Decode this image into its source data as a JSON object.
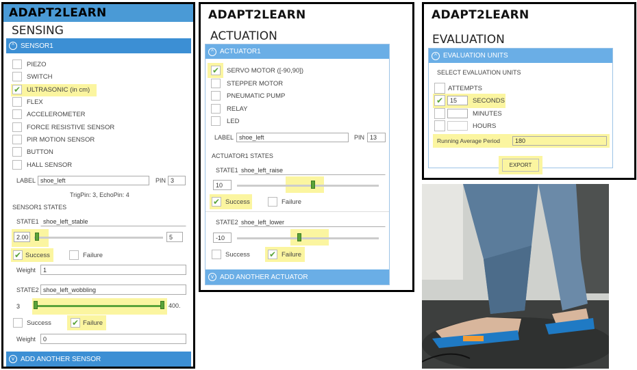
{
  "brand": "ADAPT2LEARN",
  "sensing": {
    "title": "SENSING",
    "sensor_bar": "SENSOR1",
    "sensors": [
      {
        "label": "PIEZO",
        "checked": false
      },
      {
        "label": "SWITCH",
        "checked": false
      },
      {
        "label": "ULTRASONIC (in cm)",
        "checked": true
      },
      {
        "label": "FLEX",
        "checked": false
      },
      {
        "label": "ACCELEROMETER",
        "checked": false
      },
      {
        "label": "FORCE RESISTIVE SENSOR",
        "checked": false
      },
      {
        "label": "PIR MOTION SENSOR",
        "checked": false
      },
      {
        "label": "BUTTON",
        "checked": false
      },
      {
        "label": "HALL SENSOR",
        "checked": false
      }
    ],
    "label_caption": "LABEL",
    "label_value": "shoe_left",
    "pin_caption": "PIN",
    "pin_value": "3",
    "pins_note": "TrigPin: 3, EchoPin: 4",
    "states_title": "SENSOR1 STATES",
    "state1": {
      "caption": "STATE1",
      "name": "shoe_left_stable",
      "min": "2.00",
      "max": "5",
      "success_label": "Success",
      "failure_label": "Failure",
      "weight_caption": "Weight",
      "weight_value": "1"
    },
    "state2": {
      "caption": "STATE2",
      "name": "shoe_left_wobbling",
      "min": "3",
      "max": "400.",
      "success_label": "Success",
      "failure_label": "Failure",
      "weight_caption": "Weight",
      "weight_value": "0"
    },
    "add_button": "ADD ANOTHER SENSOR"
  },
  "actuation": {
    "title": "ACTUATION",
    "actuator_bar": "ACTUATOR1",
    "actuators": [
      {
        "label": "SERVO MOTOR ([-90,90])",
        "checked": true
      },
      {
        "label": "STEPPER MOTOR",
        "checked": false
      },
      {
        "label": "PNEUMATIC PUMP",
        "checked": false
      },
      {
        "label": "RELAY",
        "checked": false
      },
      {
        "label": "LED",
        "checked": false
      }
    ],
    "label_caption": "LABEL",
    "label_value": "shoe_left",
    "pin_caption": "PIN",
    "pin_value": "13",
    "states_title": "ACTUATOR1 STATES",
    "state1": {
      "caption": "STATE1",
      "name": "shoe_left_raise",
      "value": "10",
      "success_label": "Success",
      "failure_label": "Failure"
    },
    "state2": {
      "caption": "STATE2",
      "name": "shoe_left_lower",
      "value": "-10",
      "success_label": "Success",
      "failure_label": "Failure"
    },
    "add_button": "ADD ANOTHER ACTUATOR"
  },
  "evaluation": {
    "title": "EVALUATION",
    "units_bar": "EVALUATION UNITS",
    "select_caption": "SELECT EVALUATION UNITS",
    "units": [
      {
        "label": "ATTEMPTS",
        "value": "",
        "checked": false
      },
      {
        "label": "SECONDS",
        "value": "15",
        "checked": true
      },
      {
        "label": "MINUTES",
        "value": "",
        "checked": false
      },
      {
        "label": "HOURS",
        "value": "",
        "checked": false
      }
    ],
    "running_caption": "Running Average Period",
    "running_value": "180",
    "export_button": "EXPORT"
  },
  "colors": {
    "accent": "#3c8fd4",
    "highlight": "#fbf5a0",
    "check": "#5aa33a"
  }
}
